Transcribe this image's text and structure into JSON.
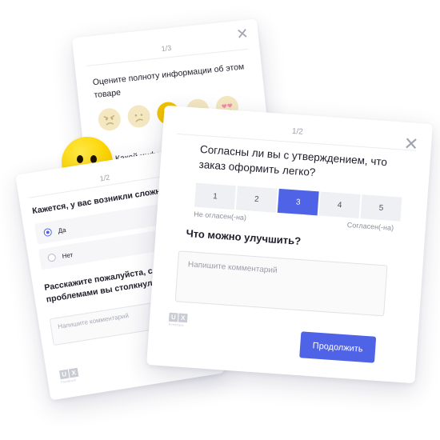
{
  "rating_card": {
    "counter": "1/3",
    "question": "Оцените полноту информации об этом товаре",
    "faces": [
      "angry-face-icon",
      "sad-face-icon",
      "neutral-face-icon",
      "smile-face-icon",
      "heart-eyes-face-icon"
    ],
    "selected_face_index": 2,
    "next_question_partial": "Какой информаци"
  },
  "left_card": {
    "counter": "1/2",
    "question": "Кажется, у вас возникли сложности?",
    "options": [
      {
        "label": "Да",
        "selected": true
      },
      {
        "label": "Нет",
        "selected": false
      }
    ],
    "followup": "Расскажите пожалуйста, с какими проблемами вы столкнулись",
    "comment_placeholder": "Напишите комментарий",
    "logo_text": "U X",
    "logo_sub": "Feedback"
  },
  "main_card": {
    "counter": "1/2",
    "question": "Согласны ли вы с утверждением, что заказ оформить легко?",
    "scale": [
      "1",
      "2",
      "3",
      "4",
      "5"
    ],
    "selected_value": 3,
    "scale_low": "Не огласен(-на)",
    "scale_high": "Согласен(-на)",
    "improve_question": "Что можно улучшить?",
    "comment_placeholder": "Напишите комментарий",
    "continue_label": "Продолжить",
    "logo_text": "U X",
    "logo_sub": "Feedback"
  },
  "colors": {
    "accent": "#4f63e6",
    "emoji_yellow": "#fcd400",
    "emoji_pale": "#f4e8c2"
  }
}
